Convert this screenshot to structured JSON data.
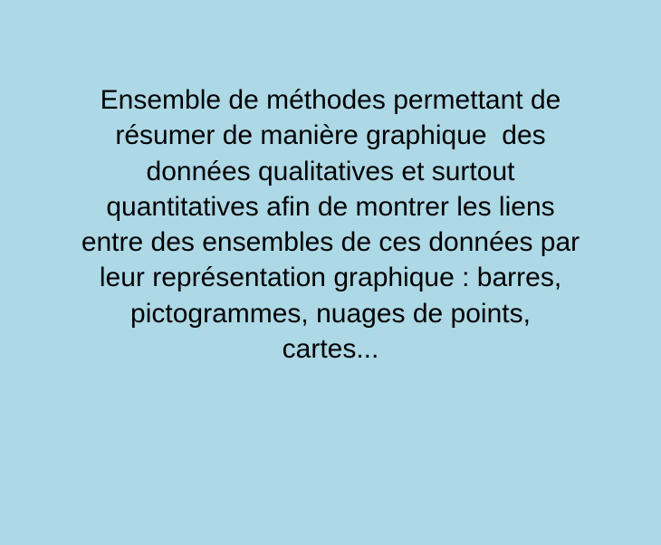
{
  "slide": {
    "background_color": "#add8e6",
    "text_color": "#000000",
    "lines": [
      "Ensemble de méthodes permettant de",
      "résumer de manière graphique  des",
      "données qualitatives et surtout",
      "quantitatives afin de montrer les liens",
      "entre des ensembles de ces données par",
      "leur représentation graphique : barres,",
      "pictogrammes, nuages de points,",
      "cartes..."
    ]
  }
}
